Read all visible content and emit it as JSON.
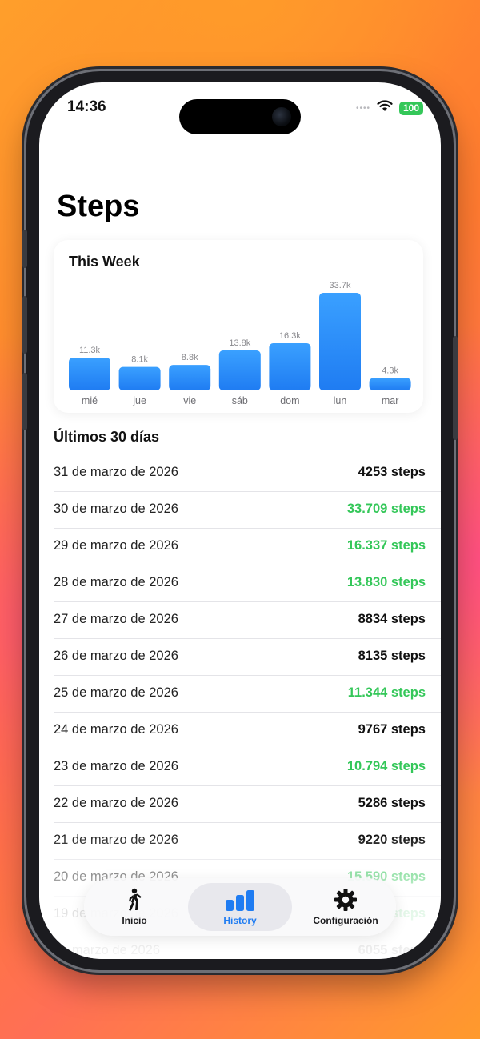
{
  "status": {
    "time": "14:36",
    "battery": "100",
    "signal_dots": "••••"
  },
  "page": {
    "title": "Steps"
  },
  "week_card": {
    "title": "This Week"
  },
  "chart_data": {
    "type": "bar",
    "title": "This Week",
    "categories": [
      "mié",
      "jue",
      "vie",
      "sáb",
      "dom",
      "lun",
      "mar"
    ],
    "values": [
      11.3,
      8.1,
      8.8,
      13.8,
      16.3,
      33.7,
      4.3
    ],
    "value_labels": [
      "11.3k",
      "8.1k",
      "8.8k",
      "13.8k",
      "16.3k",
      "33.7k",
      "4.3k"
    ],
    "ylim": [
      0,
      33.7
    ],
    "grid": false,
    "bar_color_top": "#3aa0ff",
    "bar_color_bottom": "#1f7cf2"
  },
  "history": {
    "title": "Últimos 30 días",
    "high_color": "#34c759",
    "rows": [
      {
        "date": "31 de marzo de 2026",
        "steps": "4253 steps",
        "high": false
      },
      {
        "date": "30 de marzo de 2026",
        "steps": "33.709 steps",
        "high": true
      },
      {
        "date": "29 de marzo de 2026",
        "steps": "16.337 steps",
        "high": true
      },
      {
        "date": "28 de marzo de 2026",
        "steps": "13.830 steps",
        "high": true
      },
      {
        "date": "27 de marzo de 2026",
        "steps": "8834 steps",
        "high": false
      },
      {
        "date": "26 de marzo de 2026",
        "steps": "8135 steps",
        "high": false
      },
      {
        "date": "25 de marzo de 2026",
        "steps": "11.344 steps",
        "high": true
      },
      {
        "date": "24 de marzo de 2026",
        "steps": "9767 steps",
        "high": false
      },
      {
        "date": "23 de marzo de 2026",
        "steps": "10.794 steps",
        "high": true
      },
      {
        "date": "22 de marzo de 2026",
        "steps": "5286 steps",
        "high": false
      },
      {
        "date": "21 de marzo de 2026",
        "steps": "9220 steps",
        "high": false
      },
      {
        "date": "20 de marzo de 2026",
        "steps": "15.590 steps",
        "high": true
      },
      {
        "date": "19 de marzo de 2026",
        "steps": "steps",
        "high": true
      },
      {
        "date": "de marzo de 2026",
        "steps": "6055 steps",
        "high": false
      }
    ]
  },
  "tabs": [
    {
      "label": "Inicio",
      "icon": "walking-person-icon",
      "active": false
    },
    {
      "label": "History",
      "icon": "bar-chart-icon",
      "active": true
    },
    {
      "label": "Configuración",
      "icon": "gear-icon",
      "active": false
    }
  ]
}
